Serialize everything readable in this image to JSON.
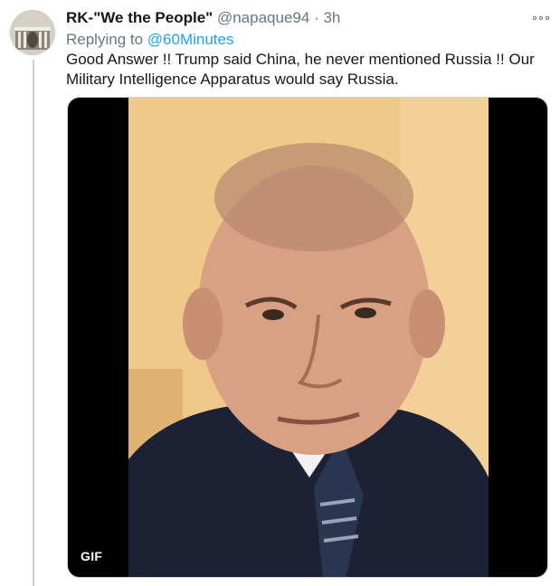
{
  "tweet": {
    "display_name": "RK-\"We the People\"",
    "handle": "@napaque94",
    "separator": "·",
    "time": "3h",
    "replying_prefix": "Replying to ",
    "replying_to": "@60Minutes",
    "text": "Good Answer !! Trump said China, he never mentioned Russia !!  Our Military Intelligence Apparatus would say Russia."
  },
  "media": {
    "type": "gif",
    "badge_label": "GIF",
    "icons": {
      "more": "more-options-icon"
    }
  },
  "colors": {
    "link": "#1da1f2",
    "secondary_text": "#657786",
    "primary_text": "#14171a",
    "thread_line": "#c4cfd6"
  }
}
